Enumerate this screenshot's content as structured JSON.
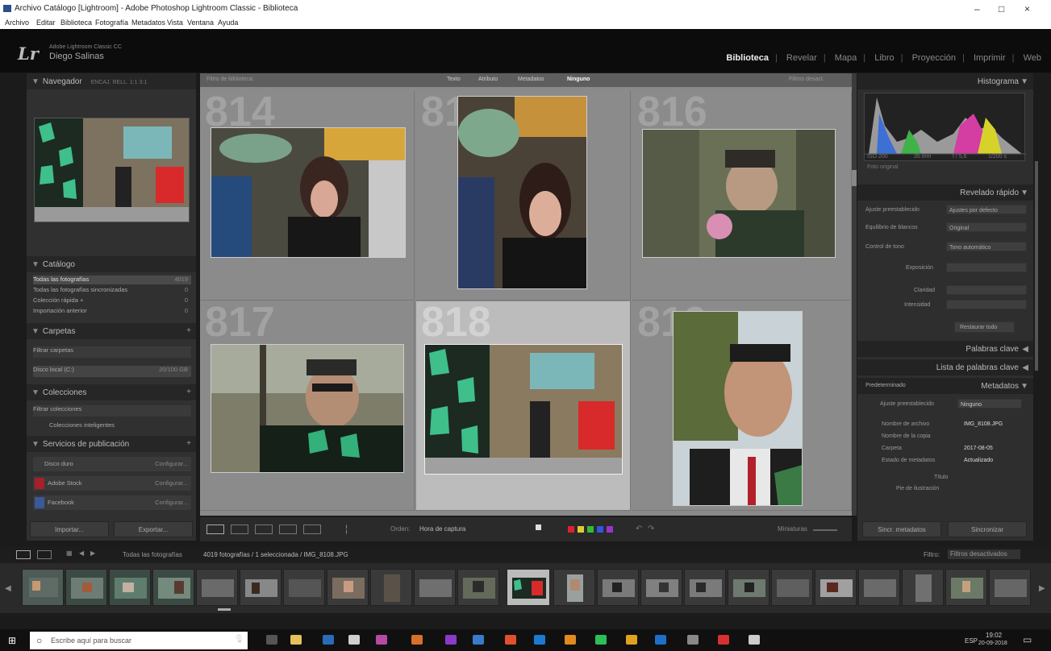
{
  "window": {
    "title": "Archivo Catálogo [Lightroom] - Adobe Photoshop Lightroom Classic - Biblioteca",
    "controls": [
      "–",
      "□",
      "×"
    ]
  },
  "menu": [
    "Archivo",
    "Editar",
    "Biblioteca",
    "Fotografía",
    "Metadatos",
    "Vista",
    "Ventana",
    "Ayuda"
  ],
  "identity": {
    "logo": "Lr",
    "catalog": "Adobe Lightroom Classic CC",
    "user": "Diego Salinas"
  },
  "modules": [
    "Biblioteca",
    "Revelar",
    "Mapa",
    "Libro",
    "Proyección",
    "Imprimir",
    "Web"
  ],
  "active_module": "Biblioteca",
  "left": {
    "navigator": {
      "title": "Navegador",
      "zoom_opts": "ENCAJ.  RELL.  1:1  3:1"
    },
    "catalog": {
      "title": "Catálogo",
      "rows": [
        {
          "label": "Todas las fotografías",
          "count": "4019"
        },
        {
          "label": "Todas las fotografías sincronizadas",
          "count": "0"
        },
        {
          "label": "Colección rápida +",
          "count": "0"
        },
        {
          "label": "Importación anterior",
          "count": "0"
        }
      ]
    },
    "folders": {
      "title": "Carpetas",
      "filter": "Filtrar carpetas",
      "volume": "Disco local (C:)",
      "volume_info": "20/100 GB"
    },
    "collections": {
      "title": "Colecciones",
      "filter": "Filtrar colecciones",
      "set": "Colecciones inteligentes"
    },
    "publish": {
      "title": "Servicios de publicación",
      "services": [
        {
          "name": "Disco duro",
          "action": "Configurar..."
        },
        {
          "name": "Adobe Stock",
          "action": "Configurar..."
        },
        {
          "name": "Facebook",
          "action": "Configurar..."
        }
      ]
    },
    "import_btn": "Importar...",
    "export_btn": "Exportar..."
  },
  "grid": {
    "filter_label": "Filtro de biblioteca:",
    "filter_tabs": [
      "Texto",
      "Atributo",
      "Metadatos",
      "Ninguno"
    ],
    "filter_active": "Ninguno",
    "filter_preset": "Filtros desact.",
    "cells": [
      {
        "num": "814"
      },
      {
        "num": "815"
      },
      {
        "num": "816"
      },
      {
        "num": "817"
      },
      {
        "num": "818"
      },
      {
        "num": "819"
      }
    ]
  },
  "toolbar": {
    "sort_label": "Orden:",
    "sort_value": "Hora de captura",
    "thumbs_label": "Miniaturas"
  },
  "right": {
    "histogram": {
      "title": "Histograma",
      "info": [
        "ISO 200",
        "35 mm",
        "f / 5,6",
        "1/200 s"
      ],
      "original": "Foto original"
    },
    "quick_develop": {
      "title": "Revelado rápido",
      "preset_label": "Ajuste preestablecido",
      "preset_value": "Ajustes por defecto",
      "wb_label": "Equilibrio de blancos",
      "wb_value": "Original",
      "tone_label": "Control de tono",
      "tone_btn": "Tono automático",
      "exposure_label": "Exposición",
      "clarity_label": "Claridad",
      "vibrance_label": "Intensidad",
      "reset": "Restaurar todo"
    },
    "keywords": {
      "title": "Palabras clave"
    },
    "keyword_list": {
      "title": "Lista de palabras clave"
    },
    "metadata": {
      "title": "Metadatos",
      "preset_label": "Predeterminado",
      "preset_label2": "Ajuste preestablecido",
      "preset_value": "Ninguno",
      "fields": [
        {
          "label": "Nombre de archivo",
          "value": "IMG_8108.JPG"
        },
        {
          "label": "Nombre de la copia",
          "value": ""
        },
        {
          "label": "Carpeta",
          "value": "2017-08-05"
        },
        {
          "label": "Estado de metadatos",
          "value": "Actualizado"
        },
        {
          "label": "Título",
          "value": ""
        },
        {
          "label": "Pie de ilustración",
          "value": ""
        }
      ]
    },
    "sync_meta": "Sincr. metadatos",
    "sync_settings": "Sincronizar"
  },
  "filmstrip": {
    "source": "Todas las fotografías",
    "status": "4019 fotografías / 1 seleccionada / IMG_8108.JPG",
    "filter_label": "Filtro:",
    "filter_value": "Filtros desactivados"
  },
  "taskbar": {
    "search_placeholder": "Escribe aquí para buscar",
    "lang": "ESP",
    "time": "19:02",
    "date": "20-09-2018"
  },
  "colors": {
    "accent": "#eeeeee",
    "panel": "#303030",
    "grid_bg": "#8a8a8a",
    "selected_cell": "#bcbcbc"
  }
}
